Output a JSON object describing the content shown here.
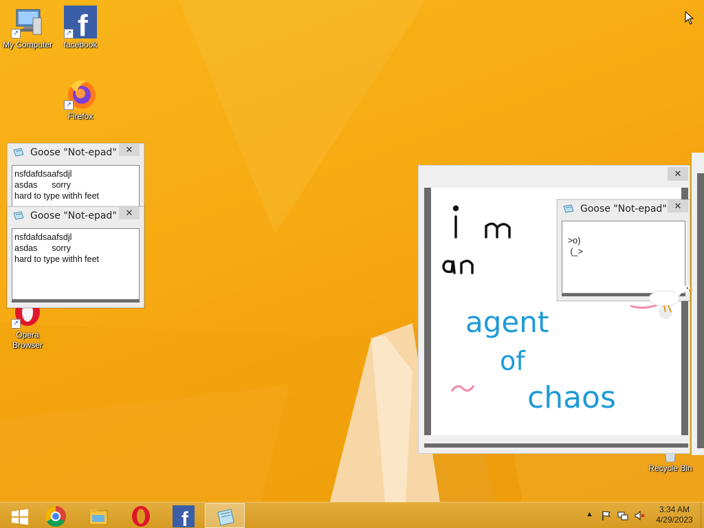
{
  "desktop": {
    "icons": [
      {
        "label": "My Computer",
        "icon": "computer-icon"
      },
      {
        "label": "facebook",
        "icon": "facebook-icon"
      },
      {
        "label": "Firefox",
        "icon": "firefox-icon"
      },
      {
        "label": "Opera\nBrowser",
        "icon": "opera-icon"
      },
      {
        "label": "Recycle Bin",
        "icon": "recycle-bin-icon"
      }
    ]
  },
  "notepads": [
    {
      "title": "Goose \"Not-epad\"",
      "close": "✕",
      "text": "nsfdafdsaafsdjl\nasdas      sorry\nhard to type withh feet"
    },
    {
      "title": "Goose \"Not-epad\"",
      "close": "✕",
      "text": "nsfdafdsaafsdjl\nasdas      sorry\nhard to type withh feet"
    },
    {
      "title": "Goose \"Not-epad\"",
      "close": "✕",
      "text": ">o)\n (_>"
    }
  ],
  "paint": {
    "close": "✕",
    "drawing_text": [
      "i m",
      "an",
      "agent",
      "of",
      "chaos",
      "~"
    ],
    "colors": {
      "black": "#111111",
      "blue": "#1e9ad6",
      "pink": "#f08aa8"
    }
  },
  "taskbar": {
    "apps": [
      {
        "name": "start",
        "icon": "windows-logo-icon"
      },
      {
        "name": "chrome",
        "icon": "chrome-icon"
      },
      {
        "name": "explorer",
        "icon": "file-explorer-icon"
      },
      {
        "name": "opera",
        "icon": "opera-icon"
      },
      {
        "name": "facebook",
        "icon": "facebook-icon"
      },
      {
        "name": "notepad",
        "icon": "notepad-icon"
      }
    ],
    "tray": {
      "expand": "▲",
      "time": "3:34 AM",
      "date": "4/29/2023"
    }
  }
}
